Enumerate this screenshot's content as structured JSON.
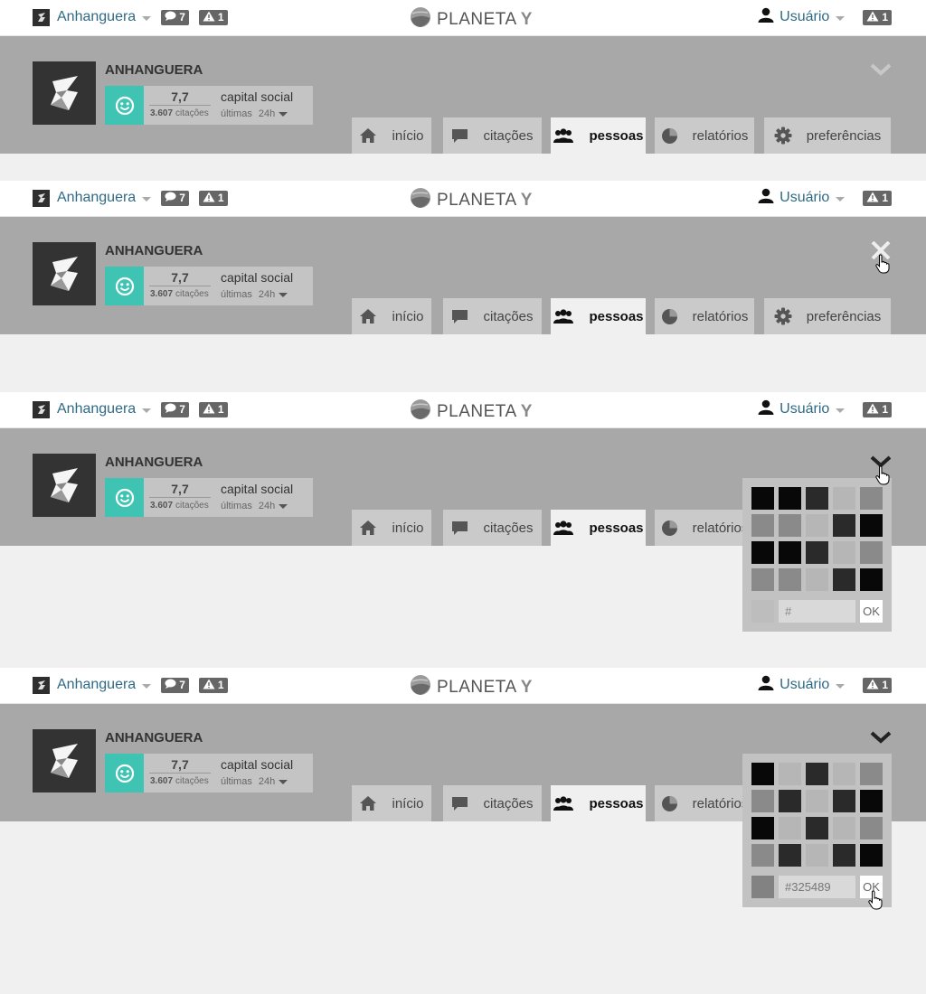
{
  "header": {
    "org_name": "Anhanguera",
    "messages_count": "7",
    "alerts_count": "1",
    "logo_text": "PLANETA",
    "logo_y": "Y",
    "user_label": "Usuário",
    "user_alerts": "1"
  },
  "profile": {
    "title": "ANHANGUERA",
    "score": "7,7",
    "score_label": "capital social",
    "citations_count": "3.607",
    "citations_word": "citações",
    "period_label": "últimas",
    "period_value": "24h"
  },
  "tabs": [
    {
      "label": "início",
      "icon": "home-icon"
    },
    {
      "label": "citações",
      "icon": "chat-icon"
    },
    {
      "label": "pessoas",
      "icon": "people-icon",
      "active": true
    },
    {
      "label": "relatórios",
      "icon": "pie-chart-icon"
    },
    {
      "label": "preferências",
      "icon": "gear-icon"
    }
  ],
  "picker": {
    "placeholder": "#",
    "ok_label": "OK",
    "value_final": "#325489",
    "preview_initial": "#bdbdbd",
    "preview_final": "#828282"
  },
  "colors": {
    "accent": "#3fc4b4",
    "link": "#2f6a85",
    "panel": "#a8a8a8",
    "tab": "#cacaca"
  },
  "frames": [
    {
      "caret": "chevron-down-icon",
      "cursor": false,
      "picker": false
    },
    {
      "caret": "close-icon",
      "cursor": true,
      "picker": false
    },
    {
      "caret": "chevron-down-icon",
      "cursor": true,
      "picker": true
    },
    {
      "caret": "chevron-down-icon",
      "cursor": true,
      "picker": true
    }
  ]
}
